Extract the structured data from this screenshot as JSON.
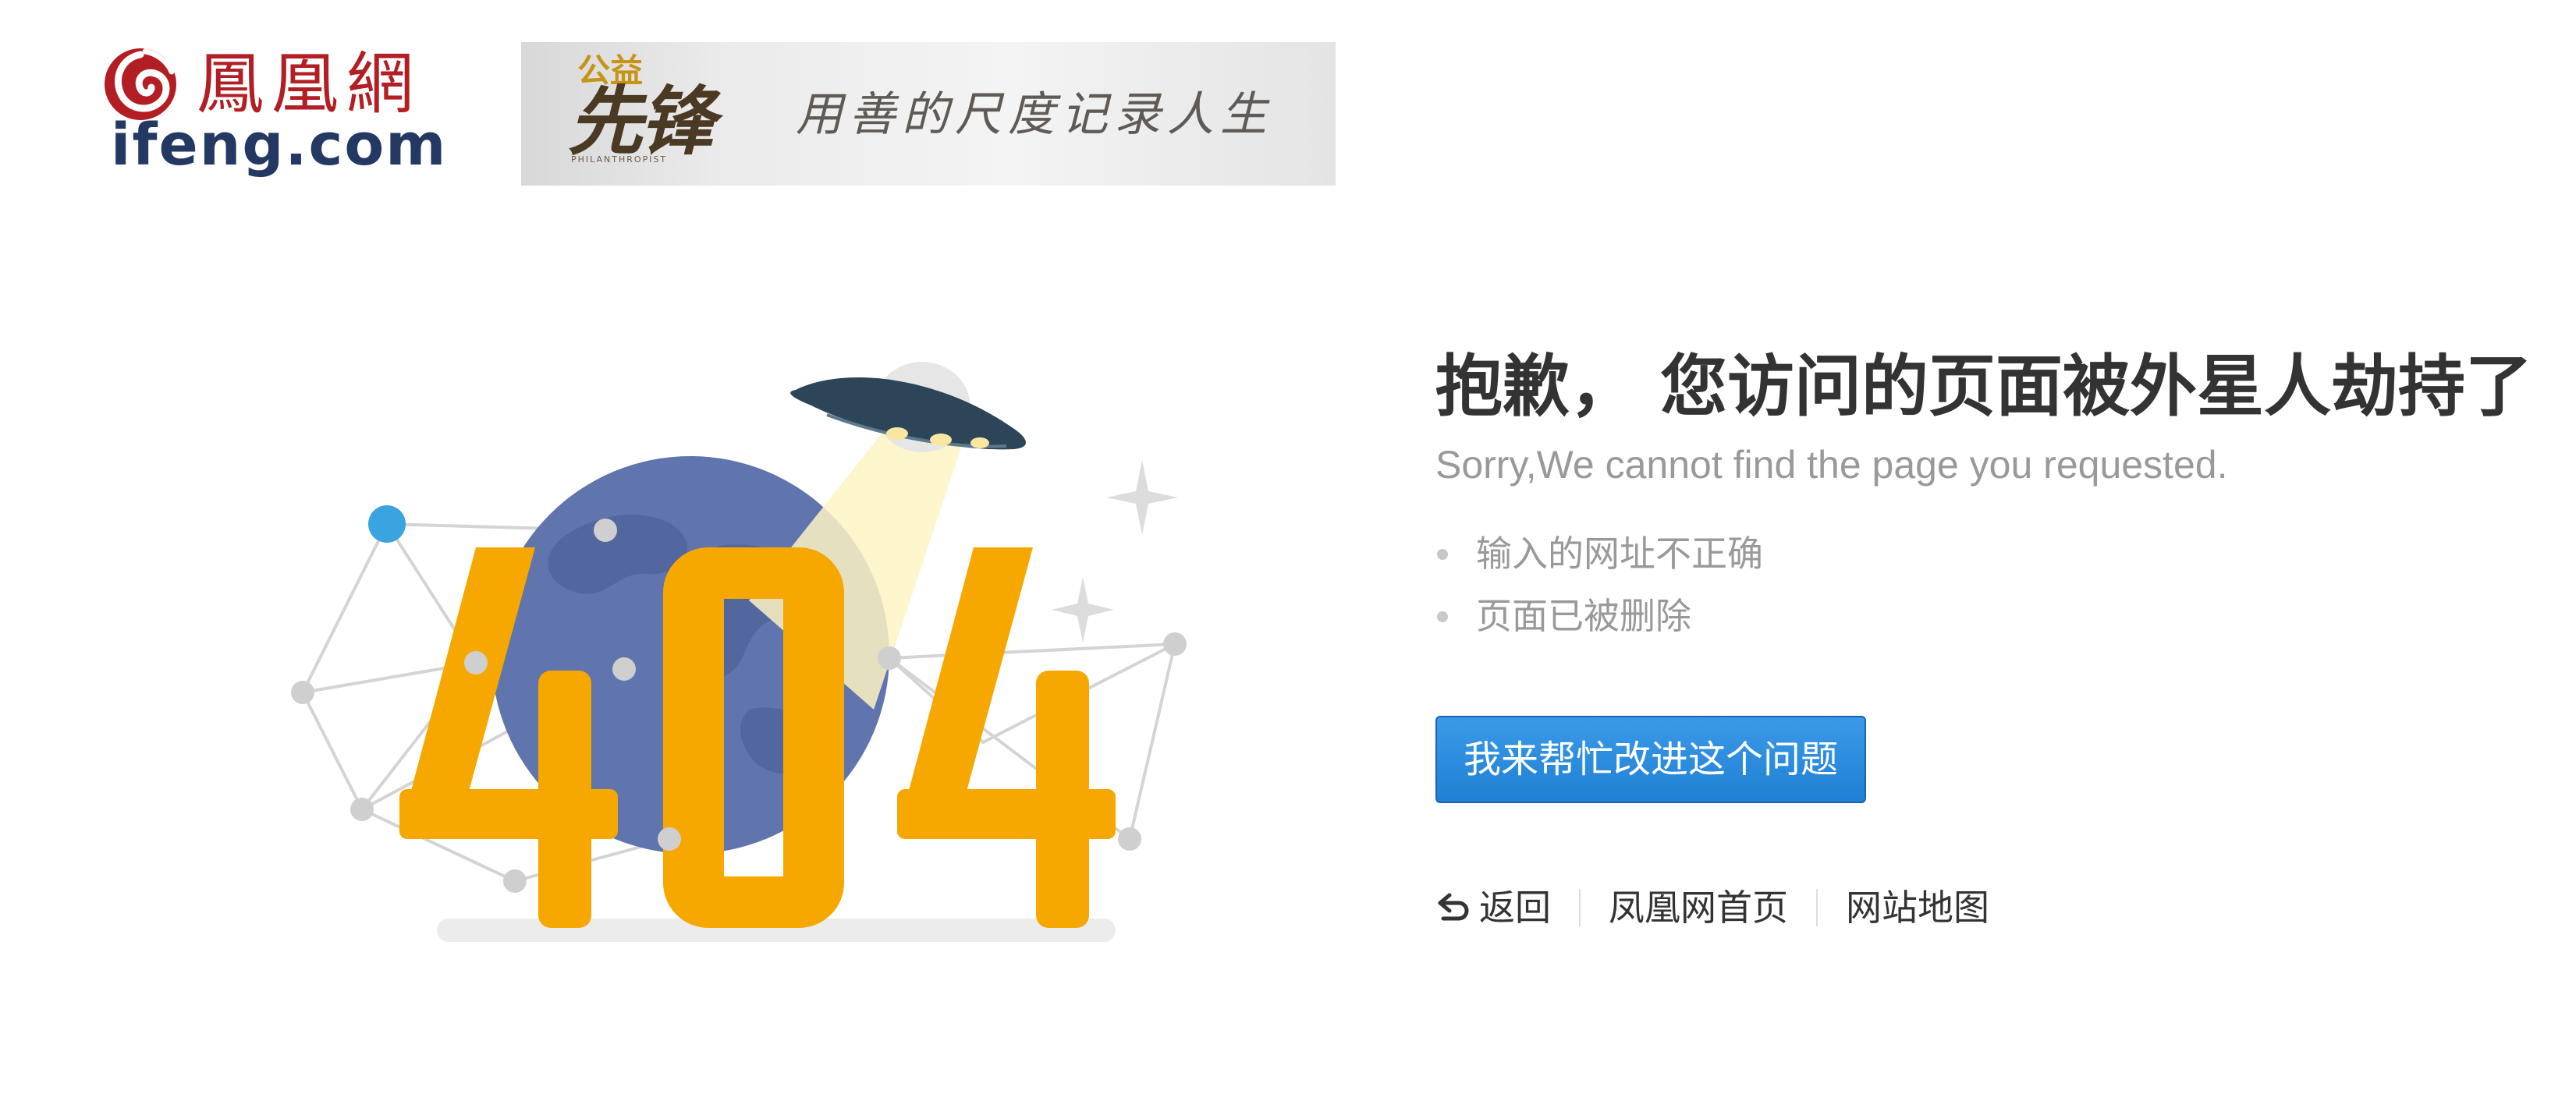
{
  "header": {
    "logo_cn": "鳳凰網",
    "logo_en": "ifeng.com",
    "banner": {
      "brand_top": "公益",
      "brand_main": "先锋",
      "brand_sub": "PHILANTHROPIST",
      "slogan": "用善的尺度记录人生"
    }
  },
  "illustration": {
    "error_code": "404",
    "colors": {
      "digits": "#f6a800",
      "globe": "#6074ad",
      "ufo": "#2c4558",
      "beam": "#fdf1b4",
      "network_node": "#cfcfcf",
      "accent_node": "#3aa3e0"
    }
  },
  "message": {
    "title": "抱歉， 您访问的页面被外星人劫持了",
    "subtitle": "Sorry,We cannot find the page you requested.",
    "reasons": [
      "输入的网址不正确",
      "页面已被删除"
    ]
  },
  "actions": {
    "help_label": "我来帮忙改进这个问题",
    "back_label": "返回",
    "home_label": "凤凰网首页",
    "sitemap_label": "网站地图"
  },
  "colors": {
    "button_bg": "#2889db",
    "title_text": "#333333",
    "muted_text": "#999999",
    "brand_red": "#b21e23",
    "brand_navy": "#233862"
  }
}
